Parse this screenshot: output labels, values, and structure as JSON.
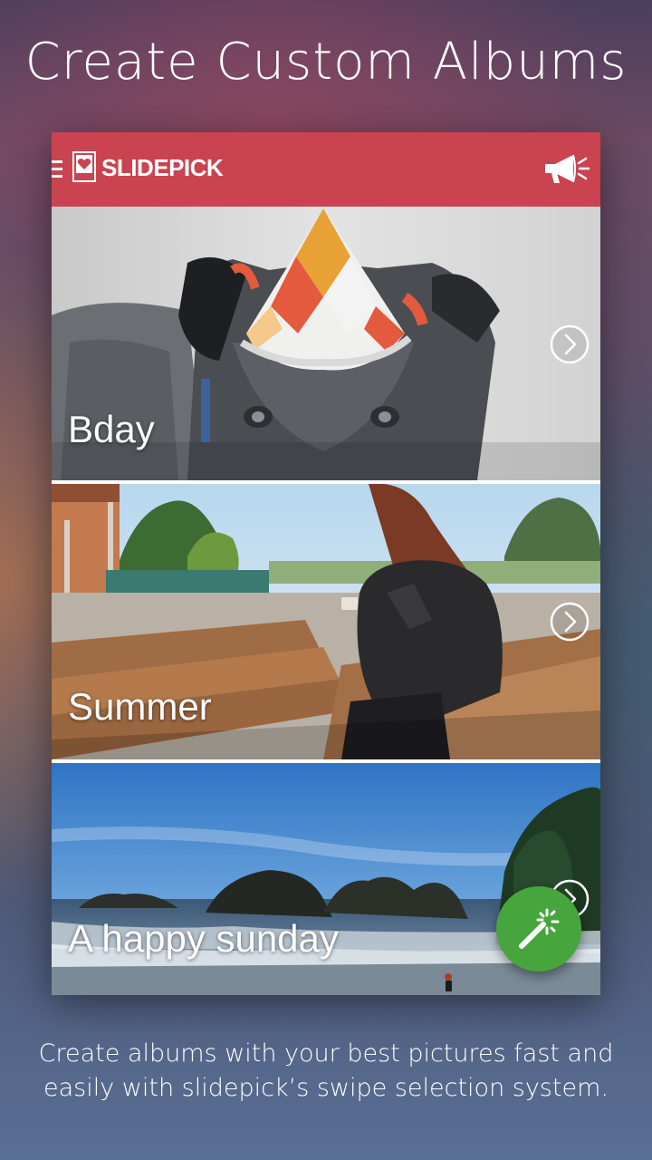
{
  "header": {
    "headline": "Create Custom Albums"
  },
  "app": {
    "brand": "SLIDEPICK",
    "bar_color": "#c94450",
    "fab_color": "#46a53c",
    "icons": {
      "menu": "hamburger-menu-icon",
      "logo": "heart-photo-icon",
      "announce": "megaphone-icon",
      "open": "chevron-right-icon",
      "create": "magic-wand-icon"
    }
  },
  "albums": [
    {
      "title": "Bday"
    },
    {
      "title": "Summer"
    },
    {
      "title": "A happy sunday"
    }
  ],
  "footer": {
    "caption_line1": "Create albums with your best pictures fast and",
    "caption_line2": "easily with slidepick’s swipe selection system."
  }
}
